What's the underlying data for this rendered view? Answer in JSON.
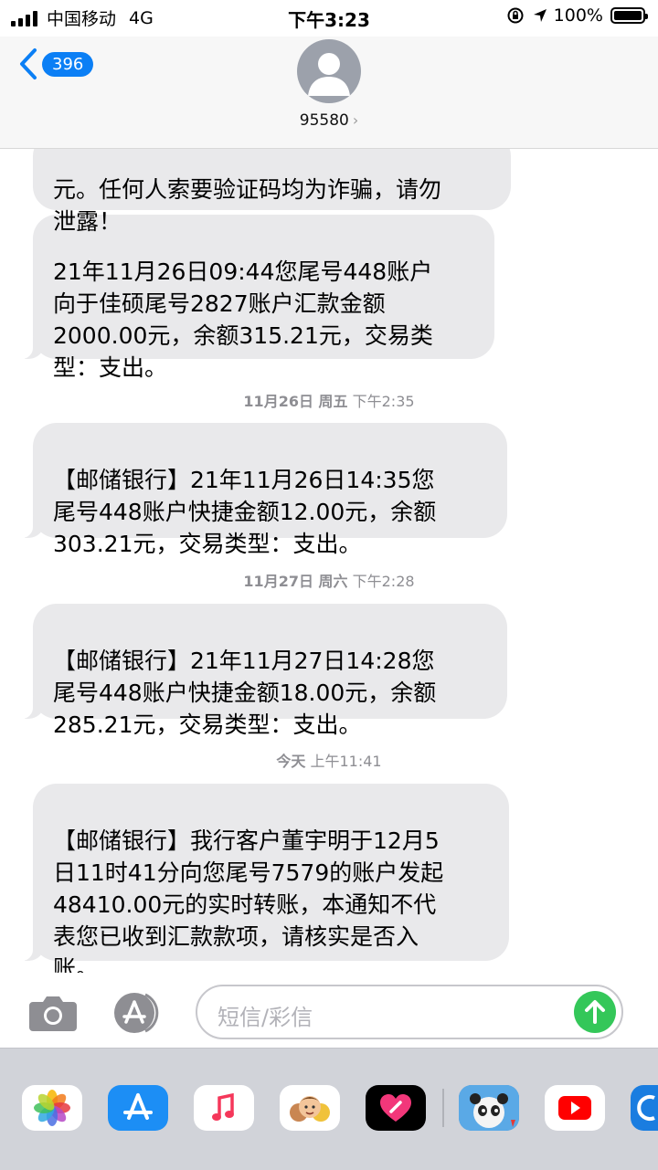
{
  "status_bar": {
    "carrier": "中国移动",
    "network": "4G",
    "time": "下午3:23",
    "battery": "100%"
  },
  "header": {
    "back_badge": "396",
    "contact_name": "95580",
    "chevron": "›"
  },
  "messages": [
    {
      "text": "元。任何人索要验证码均为诈骗，请勿\n泄露！"
    },
    {
      "text": "21年11月26日09:44您尾号448账户\n向于佳硕尾号2827账户汇款金额\n2000.00元，余额315.21元，交易类\n型：支出。"
    },
    {
      "text": "【邮储银行】21年11月26日14:35您\n尾号448账户快捷金额12.00元，余额\n303.21元，交易类型：支出。"
    },
    {
      "text": "【邮储银行】21年11月27日14:28您\n尾号448账户快捷金额18.00元，余额\n285.21元，交易类型：支出。"
    },
    {
      "text": "【邮储银行】我行客户董宇明于12月5\n日11时41分向您尾号7579的账户发起\n48410.00元的实时转账，本通知不代\n表您已收到汇款款项，请核实是否入\n账。"
    }
  ],
  "timestamps": [
    {
      "date": "11月26日 周五",
      "time": "下午2:35"
    },
    {
      "date": "11月27日 周六",
      "time": "下午2:28"
    },
    {
      "date": "今天",
      "time": "上午11:41"
    }
  ],
  "composer": {
    "placeholder": "短信/彩信"
  },
  "app_tray": [
    {
      "icon": "photos-icon"
    },
    {
      "icon": "app-store-icon"
    },
    {
      "icon": "music-icon"
    },
    {
      "icon": "memoji-icon"
    },
    {
      "icon": "digital-touch-icon"
    },
    {
      "icon": "game-panda-icon"
    },
    {
      "icon": "youtube-icon"
    },
    {
      "icon": "partial-app-icon"
    }
  ],
  "colors": {
    "accent_blue": "#0b7ff5",
    "bubble_gray": "#e9e9eb",
    "send_green": "#34c759",
    "tray_bg": "#d1d3d9"
  }
}
